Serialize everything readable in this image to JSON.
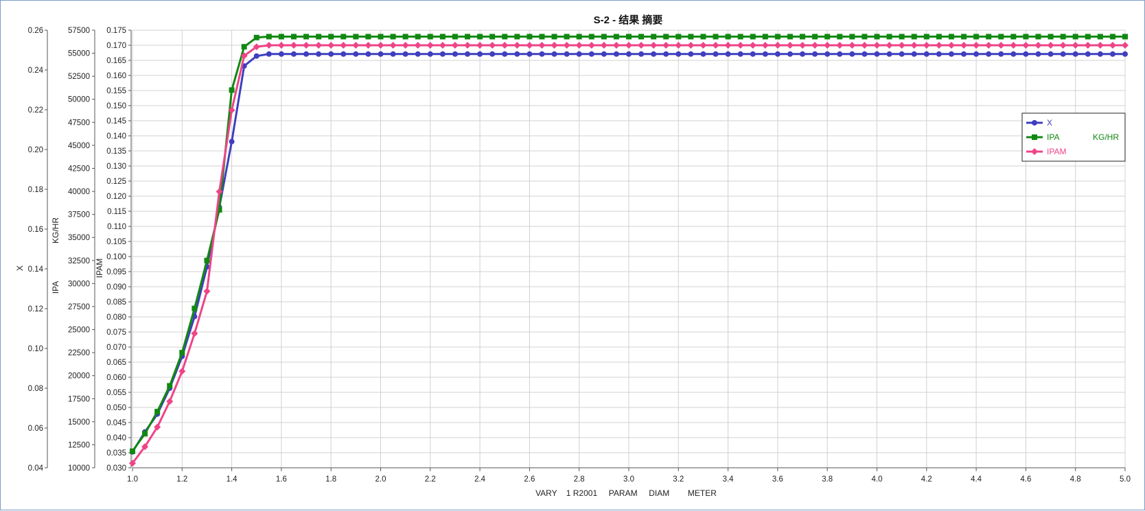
{
  "chart_data": {
    "type": "line",
    "title": "S-2 - 结果 摘要",
    "xlabel": "VARY    1 R2001     PARAM     DIAM        METER",
    "xlim": [
      1.0,
      5.0
    ],
    "x_ticks": [
      "1.0",
      "1.2",
      "1.4",
      "1.6",
      "1.8",
      "2.0",
      "2.2",
      "2.4",
      "2.6",
      "2.8",
      "3.0",
      "3.2",
      "3.4",
      "3.6",
      "3.8",
      "4.0",
      "4.2",
      "4.4",
      "4.6",
      "4.8",
      "5.0"
    ],
    "grid": true,
    "legend_position": "right",
    "x_step": 0.05,
    "axes": [
      {
        "id": "x_axis",
        "label": "X",
        "ylim": [
          0.04,
          0.26
        ],
        "ticks": [
          "0.04",
          "0.06",
          "0.08",
          "0.10",
          "0.12",
          "0.14",
          "0.16",
          "0.18",
          "0.20",
          "0.22",
          "0.24",
          "0.26"
        ]
      },
      {
        "id": "ipa_axis",
        "label": "IPA",
        "unit_label": "KG/HR",
        "ylim": [
          10000,
          57500
        ],
        "ticks": [
          "10000",
          "12500",
          "15000",
          "17500",
          "20000",
          "22500",
          "25000",
          "27500",
          "30000",
          "32500",
          "35000",
          "37500",
          "40000",
          "42500",
          "45000",
          "47500",
          "50000",
          "52500",
          "55000",
          "57500"
        ]
      },
      {
        "id": "ipam_axis",
        "label": "IPAM",
        "ylim": [
          0.03,
          0.175
        ],
        "ticks": [
          "0.030",
          "0.035",
          "0.040",
          "0.045",
          "0.050",
          "0.055",
          "0.060",
          "0.065",
          "0.070",
          "0.075",
          "0.080",
          "0.085",
          "0.090",
          "0.095",
          "0.100",
          "0.105",
          "0.110",
          "0.115",
          "0.120",
          "0.125",
          "0.130",
          "0.135",
          "0.140",
          "0.145",
          "0.150",
          "0.155",
          "0.160",
          "0.165",
          "0.170",
          "0.175"
        ]
      }
    ],
    "series": [
      {
        "name": "X",
        "unit": "",
        "axis": 0,
        "color": "#3f3fbf",
        "marker": "circle",
        "head_values": [
          0.048,
          0.058,
          0.067,
          0.08,
          0.096,
          0.116,
          0.141,
          0.171,
          0.204,
          0.242,
          0.247
        ],
        "plateau_value": 0.248
      },
      {
        "name": "IPA",
        "unit": "KG/HR",
        "axis": 1,
        "color": "#118811",
        "marker": "square",
        "head_values": [
          11800,
          13700,
          16100,
          18900,
          22500,
          27300,
          32500,
          38000,
          51000,
          55700,
          56700
        ],
        "plateau_value": 56800
      },
      {
        "name": "IPAM",
        "unit": "",
        "axis": 2,
        "color": "#ee4488",
        "marker": "diamond",
        "head_values": [
          0.0315,
          0.037,
          0.0435,
          0.052,
          0.062,
          0.0745,
          0.0885,
          0.1215,
          0.1485,
          0.1665,
          0.1695
        ],
        "plateau_value": 0.17
      }
    ]
  }
}
